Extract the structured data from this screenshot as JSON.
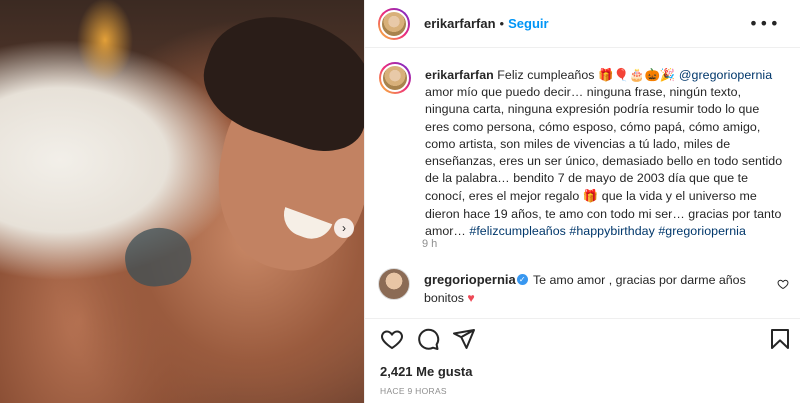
{
  "header": {
    "username": "erikarfarfan",
    "separator": "•",
    "follow_label": "Seguir",
    "more_icon": "more-horizontal-icon"
  },
  "caption": {
    "username": "erikarfarfan",
    "text_before_emojis": "Feliz cumpleaños ",
    "emojis": "🎁🎈🎂🎃🎉",
    "mention": "@gregoriopernia",
    "body_line1": "amor mío que puedo decir… ninguna frase, ningún texto,",
    "body_line2": "ninguna carta, ninguna expresión podría resumir todo lo que",
    "body_line3": "eres como persona, cómo esposo, cómo papá, cómo amigo,",
    "body_line4": "como artista, son miles de vivencias a tú lado, miles de",
    "body_line5": "enseñanzas, eres un ser único, demasiado bello en todo sentido",
    "body_line6": "de la palabra… bendito 7 de mayo de 2003 día que que te",
    "body_line7a": "conocí, eres el mejor regalo ",
    "gift_emoji": "🎁",
    "body_line7b": " que la vida y el universo me",
    "body_line8": "dieron hace 19 años, te amo con todo mi ser… gracias por tanto",
    "body_line9": "amor… ",
    "hashtag1": "#felizcumpleaños",
    "hashtag2": "#happybirthday",
    "hashtag3": "#gregoriopernia",
    "time": "9 h"
  },
  "comment": {
    "username": "gregoriopernia",
    "verified_mark": "✓",
    "text": "Te amo amor , gracias por darme años",
    "text2": "bonitos ",
    "heart": "♥",
    "like_icon": "heart-outline-icon"
  },
  "actions": {
    "like_icon": "heart-icon",
    "comment_icon": "comment-icon",
    "share_icon": "send-icon",
    "save_icon": "bookmark-icon",
    "likes": "2,421 Me gusta",
    "date": "HACE 9 HORAS"
  },
  "colors": {
    "link": "#0095f6",
    "hashtag": "#00376b",
    "secondary": "#8e8e8e",
    "heart": "#ed4956"
  }
}
